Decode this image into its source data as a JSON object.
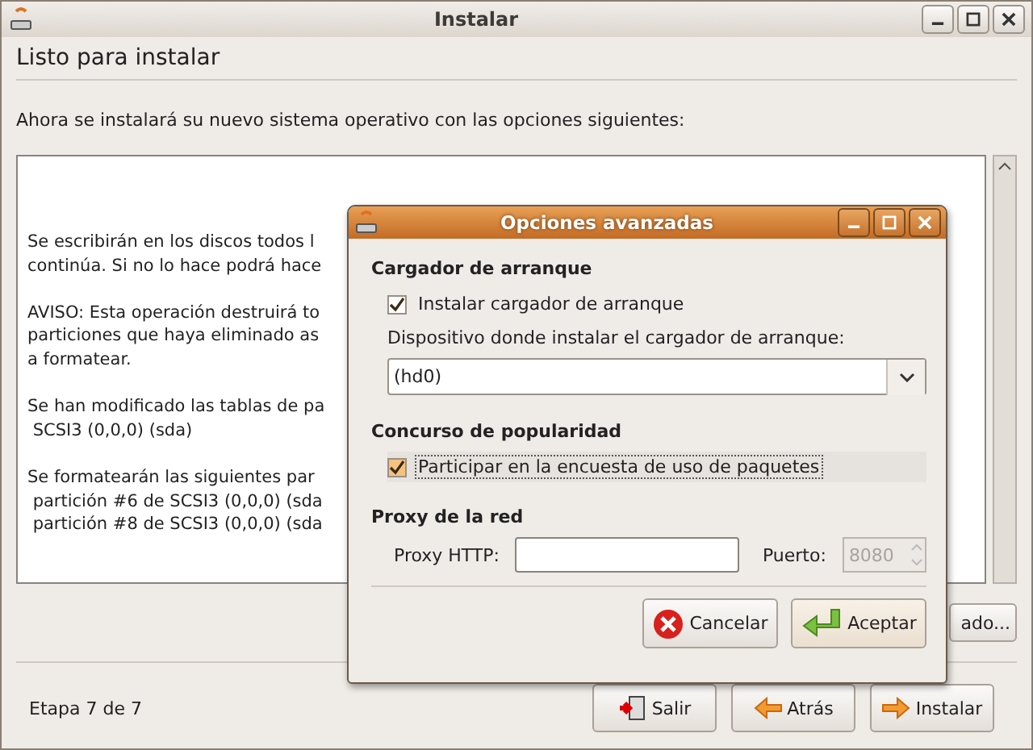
{
  "window": {
    "title": "Instalar"
  },
  "page": {
    "heading": "Listo para instalar",
    "intro": "Ahora se instalará su nuevo sistema operativo con las opciones siguientes:",
    "summary_paragraphs": [
      [
        "Se escribirán en los discos todos l",
        "continúa. Si no lo hace podrá hace"
      ],
      [
        "AVISO: Esta operación destruirá to",
        "particiones que haya eliminado as",
        "a formatear."
      ],
      [
        "Se han modificado las tablas de pa",
        " SCSI3 (0,0,0) (sda)"
      ],
      [
        "Se formatearán las siguientes par",
        " partición #6 de SCSI3 (0,0,0) (sda",
        " partición #8 de SCSI3 (0,0,0) (sda"
      ]
    ],
    "advanced_button": "ado..."
  },
  "footer": {
    "step": "Etapa 7 de 7",
    "buttons": [
      {
        "label": "Salir",
        "kind": "quit"
      },
      {
        "label": "Atrás",
        "kind": "back"
      },
      {
        "label": "Instalar",
        "kind": "forward"
      }
    ]
  },
  "dialog": {
    "title": "Opciones avanzadas",
    "bootloader": {
      "heading": "Cargador de arranque",
      "checkbox": {
        "label": "Instalar cargador de arranque",
        "checked": true,
        "focused": false
      },
      "device_label": "Dispositivo donde instalar el cargador de arranque:",
      "device": "(hd0)"
    },
    "popcon": {
      "heading": "Concurso de popularidad",
      "checkbox": {
        "label": "Participar en la encuesta de uso de paquetes",
        "checked": true,
        "focused": true
      }
    },
    "proxy": {
      "heading": "Proxy de la red",
      "http_label": "Proxy HTTP:",
      "port_label": "Puerto:",
      "port": "8080",
      "port_disabled": true
    },
    "buttons": [
      {
        "label": "Cancelar",
        "kind": "cancel"
      },
      {
        "label": "Aceptar",
        "kind": "ok"
      }
    ]
  }
}
